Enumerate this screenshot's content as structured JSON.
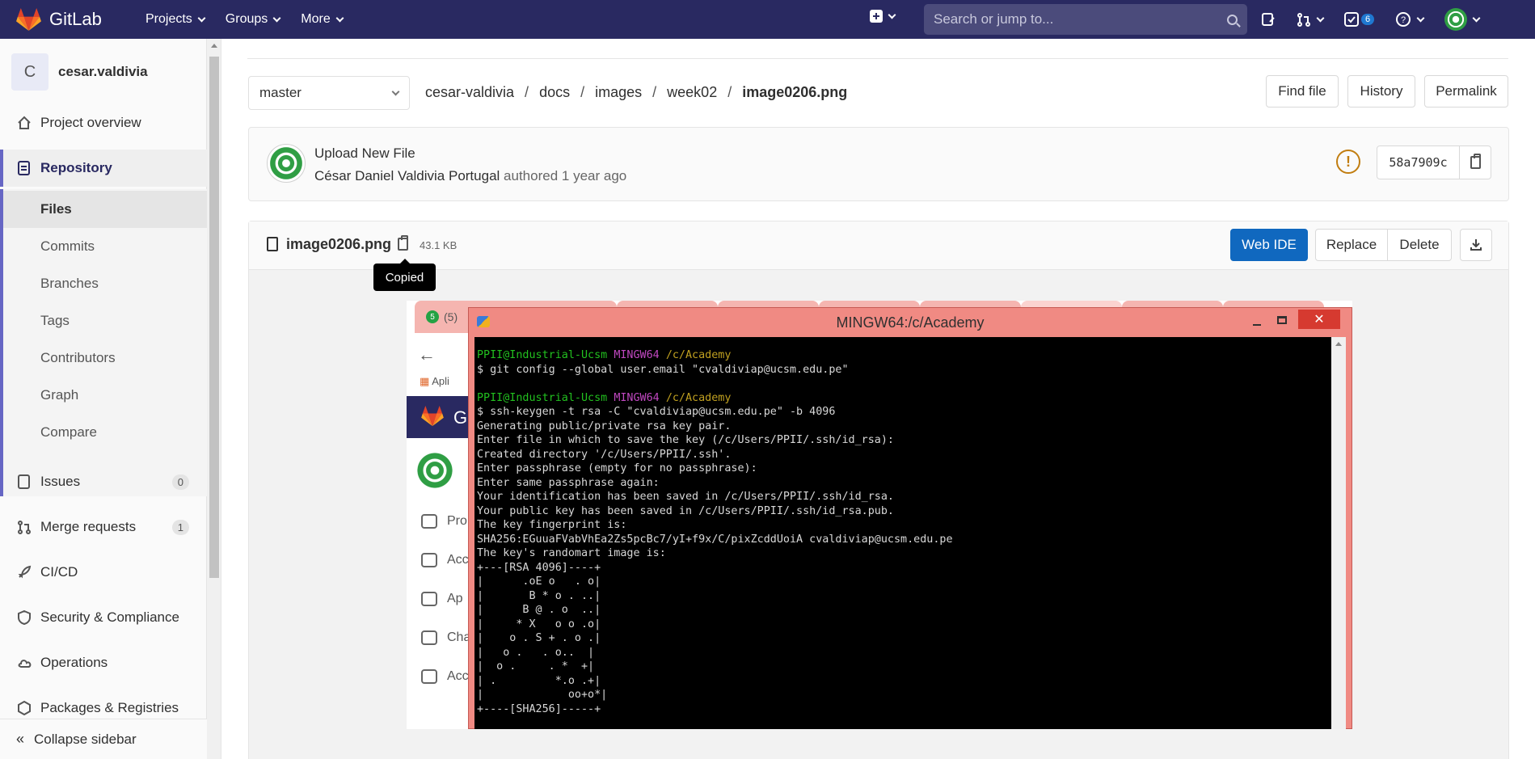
{
  "nav": {
    "brand": "GitLab",
    "menu": [
      "Projects",
      "Groups",
      "More"
    ],
    "search_placeholder": "Search or jump to...",
    "todo_count": "6",
    "colors": {
      "navbar": "#292961",
      "accent": "#6666c4",
      "primary_button": "#1068bf"
    }
  },
  "sidebar": {
    "project_initial": "C",
    "project_name": "cesar.valdivia",
    "items": {
      "overview": "Project overview",
      "repository": "Repository",
      "files": "Files",
      "commits": "Commits",
      "branches": "Branches",
      "tags": "Tags",
      "contributors": "Contributors",
      "graph": "Graph",
      "compare": "Compare",
      "issues": "Issues",
      "issues_count": "0",
      "merge_requests": "Merge requests",
      "merge_requests_count": "1",
      "cicd": "CI/CD",
      "security": "Security & Compliance",
      "operations": "Operations",
      "packages": "Packages & Registries"
    },
    "collapse": "Collapse sidebar"
  },
  "repo": {
    "branch": "master",
    "breadcrumb": [
      "cesar-valdivia",
      "docs",
      "images",
      "week02",
      "image0206.png"
    ],
    "buttons": {
      "find_file": "Find file",
      "history": "History",
      "permalink": "Permalink"
    }
  },
  "commit": {
    "title": "Upload New File",
    "author": "César Daniel Valdivia Portugal",
    "authored_text": "authored",
    "time": "1 year ago",
    "sha": "58a7909c"
  },
  "file": {
    "name": "image0206.png",
    "size": "43.1 KB",
    "tooltip": "Copied",
    "buttons": {
      "web_ide": "Web IDE",
      "replace": "Replace",
      "delete": "Delete"
    }
  },
  "image": {
    "browser_tab": "(5)",
    "bookmarks": "Apli",
    "gitlab_letter": "G",
    "side_items": [
      "Pro",
      "Acc",
      "Ap",
      "Cha",
      "Acc"
    ],
    "terminal_title": "MINGW64:/c/Academy",
    "prompt_user": "PPII@Industrial-Ucsm",
    "prompt_sys": "MINGW64",
    "prompt_dir": "/c/Academy",
    "cmd1": "$ git config --global user.email \"cvaldiviap@ucsm.edu.pe\"",
    "cmd2": "$ ssh-keygen -t rsa -C \"cvaldiviap@ucsm.edu.pe\" -b 4096",
    "output": [
      "Generating public/private rsa key pair.",
      "Enter file in which to save the key (/c/Users/PPII/.ssh/id_rsa):",
      "Created directory '/c/Users/PPII/.ssh'.",
      "Enter passphrase (empty for no passphrase):",
      "Enter same passphrase again:",
      "Your identification has been saved in /c/Users/PPII/.ssh/id_rsa.",
      "Your public key has been saved in /c/Users/PPII/.ssh/id_rsa.pub.",
      "The key fingerprint is:",
      "SHA256:EGuuaFVabVhEa2Zs5pcBc7/yI+f9x/C/pixZcddUoiA cvaldiviap@ucsm.edu.pe",
      "The key's randomart image is:",
      "+---[RSA 4096]----+",
      "|      .oE o   . o|",
      "|       B * o . ..|",
      "|      B @ . o  ..|",
      "|     * X   o o .o|",
      "|    o . S + . o .|",
      "|   o .   . o..  |",
      "|  o .     . *  +|",
      "| .         *.o .+|",
      "|             oo+o*|",
      "+----[SHA256]-----+"
    ]
  }
}
